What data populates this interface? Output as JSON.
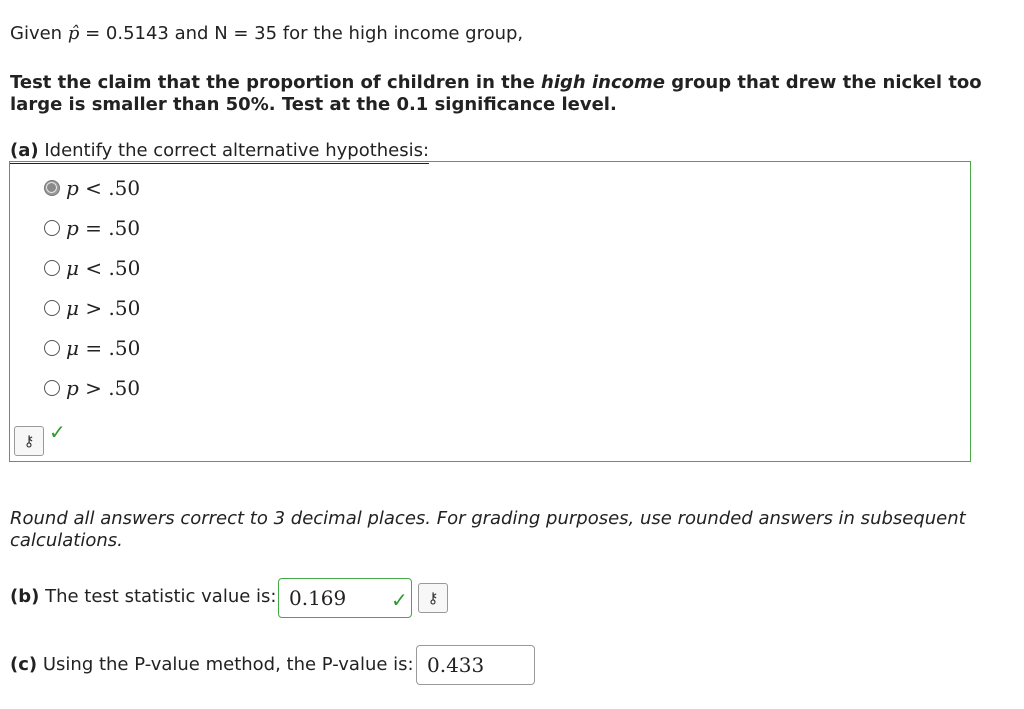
{
  "intro": {
    "given_prefix": "Given",
    "p_hat_symbol": "p̂",
    "given_rest": "= 0.5143 and N = 35 for the high income group,"
  },
  "claim": {
    "part1": "Test the claim that the proportion of children in the ",
    "emphasis": "high income",
    "part2": " group that drew the nickel too large is smaller than 50%. Test at the 0.1 significance level."
  },
  "part_a": {
    "label": "(a)",
    "question": "Identify the correct alternative hypothesis:",
    "choices": [
      {
        "var": "p",
        "op": "<",
        "val": ".50",
        "selected": true
      },
      {
        "var": "p",
        "op": "=",
        "val": ".50",
        "selected": false
      },
      {
        "var": "μ",
        "op": "<",
        "val": ".50",
        "selected": false
      },
      {
        "var": "μ",
        "op": ">",
        "val": ".50",
        "selected": false
      },
      {
        "var": "μ",
        "op": "=",
        "val": ".50",
        "selected": false
      },
      {
        "var": "p",
        "op": ">",
        "val": ".50",
        "selected": false
      }
    ],
    "status": "correct"
  },
  "rounding_note": "Round all answers correct to 3 decimal places. For grading purposes, use rounded answers in subsequent calculations.",
  "part_b": {
    "label": "(b)",
    "question": "The test statistic value is:",
    "value": "0.169",
    "status": "correct"
  },
  "part_c": {
    "label": "(c)",
    "question": "Using the P-value method, the P-value is:",
    "value": "0.433"
  },
  "icons": {
    "key_icon": "⚷",
    "check_icon": "✓"
  },
  "colors": {
    "correct_green": "#46a846",
    "check_green": "#2e9a2e"
  }
}
